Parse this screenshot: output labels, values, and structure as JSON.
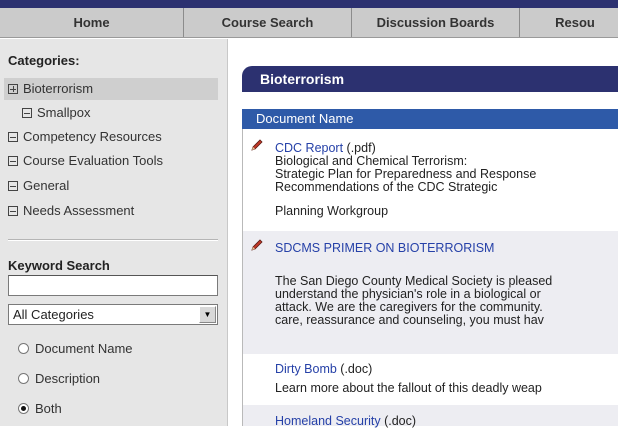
{
  "nav": {
    "tabs": [
      {
        "label": "Home"
      },
      {
        "label": "Course Search"
      },
      {
        "label": "Discussion Boards"
      },
      {
        "label": "Resou"
      }
    ]
  },
  "sidebar": {
    "categories_heading": "Categories:",
    "categories": [
      {
        "label": "Bioterrorism",
        "expander": "plus",
        "selected": true
      },
      {
        "label": "Smallpox",
        "expander": "minus",
        "child": true
      },
      {
        "label": "Competency Resources",
        "expander": "minus"
      },
      {
        "label": "Course Evaluation Tools",
        "expander": "minus"
      },
      {
        "label": "General",
        "expander": "minus"
      },
      {
        "label": "Needs Assessment",
        "expander": "minus"
      }
    ],
    "keyword_heading": "Keyword Search",
    "keyword_value": "",
    "category_select": "All Categories",
    "search_options": [
      {
        "label": "Document Name",
        "checked": false
      },
      {
        "label": "Description",
        "checked": false
      },
      {
        "label": "Both",
        "checked": true
      }
    ]
  },
  "main": {
    "section_title": "Bioterrorism",
    "column_header": "Document Name",
    "documents": [
      {
        "title": "CDC Report",
        "ext": " (.pdf)",
        "description": "Biological and Chemical Terrorism:\nStrategic Plan for Preparedness and Response\nRecommendations of the CDC Strategic",
        "note": "Planning Workgroup"
      },
      {
        "title": "SDCMS PRIMER ON BIOTERRORISM",
        "ext": "",
        "description": "The San Diego County Medical Society is pleased\nunderstand the physician's role in a biological or\nattack. We are the caregivers for the community.\ncare, reassurance and counseling, you must hav"
      },
      {
        "title": "Dirty Bomb",
        "ext": " (.doc)",
        "description": "Learn more about the fallout of this deadly weap"
      },
      {
        "title": "Homeland Security",
        "ext": " (.doc)",
        "description": ""
      }
    ]
  },
  "colors": {
    "nav_bg": "#cbcbcb",
    "title_bar": "#2c3170",
    "header_bar": "#2e5aa8",
    "link": "#2641a8",
    "sidebar_bg": "#e6e6e6"
  }
}
